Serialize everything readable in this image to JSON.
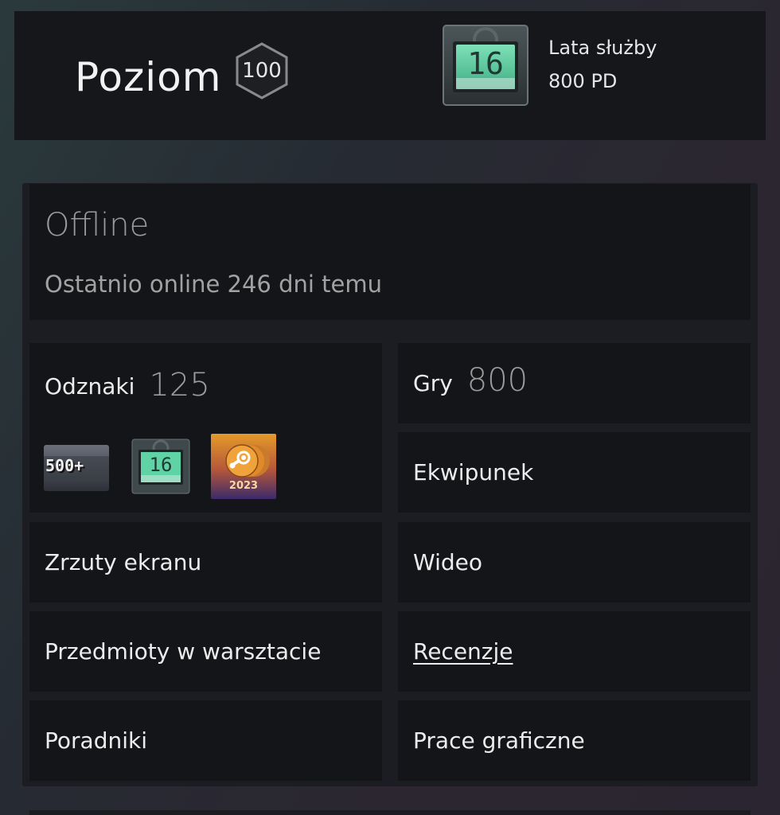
{
  "level": {
    "label": "Poziom",
    "value": "100"
  },
  "years_of_service": {
    "badge_number": "16",
    "title": "Lata służby",
    "xp": "800 PD"
  },
  "status": {
    "title": "Offline",
    "last_online": "Ostatnio online 246 dni temu"
  },
  "badges": {
    "label": "Odznaki",
    "count": "125",
    "items": [
      {
        "icon": "500-plus-badge-icon",
        "text": "500+"
      },
      {
        "icon": "years-of-service-badge-icon",
        "text": "16"
      },
      {
        "icon": "steam-2023-badge-icon",
        "text": "2023"
      }
    ]
  },
  "games": {
    "label": "Gry",
    "count": "800"
  },
  "links": {
    "inventory": "Ekwipunek",
    "screenshots": "Zrzuty ekranu",
    "videos": "Wideo",
    "workshop": "Przedmioty w warsztacie",
    "reviews": "Recenzje",
    "guides": "Poradniki",
    "artwork": "Prace graficzne"
  },
  "colors": {
    "badge_green": "#5fd3a6",
    "badge_2023_orange": "#e59a2a",
    "badge_2023_purple": "#3b2a6b"
  }
}
